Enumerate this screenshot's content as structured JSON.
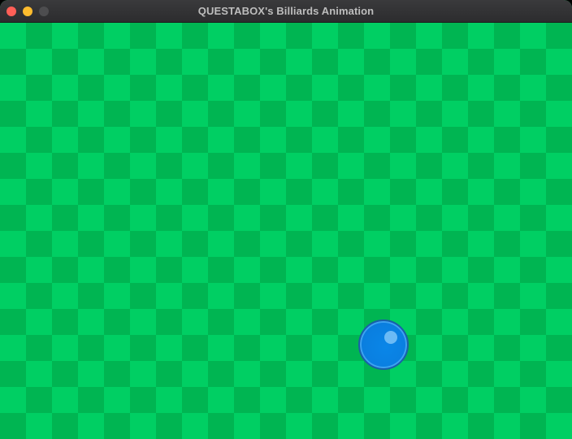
{
  "window": {
    "title": "QUESTABOX's Billiards Animation",
    "controls": {
      "close_color": "#ff5f57",
      "minimize_color": "#febc2e",
      "zoom_color": "#4d4d4f"
    }
  },
  "board": {
    "pattern": "checkerboard",
    "light_color": "#00cf63",
    "dark_color": "#00b552"
  },
  "ball": {
    "color": "#0a7fe0",
    "highlight_color": "#7cc4f8",
    "icon": "billiard-ball"
  }
}
